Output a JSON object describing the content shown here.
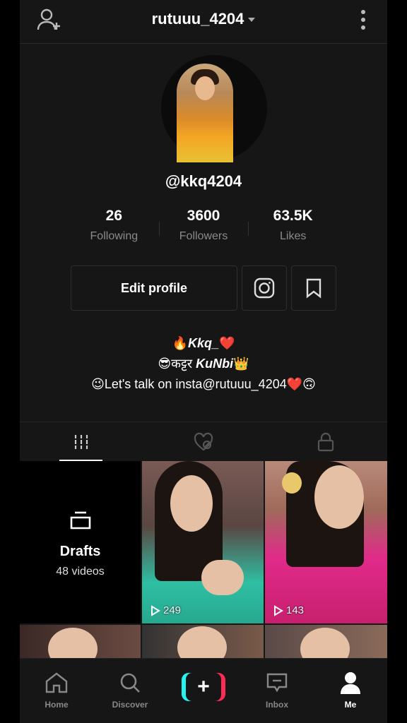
{
  "header": {
    "username": "rutuuu_4204"
  },
  "profile": {
    "handle": "@kkq4204"
  },
  "stats": [
    {
      "value": "26",
      "label": "Following"
    },
    {
      "value": "3600",
      "label": "Followers"
    },
    {
      "value": "63.5K",
      "label": "Likes"
    }
  ],
  "actions": {
    "edit_profile": "Edit profile"
  },
  "bio": {
    "line1_emoji_a": "🔥",
    "line1_text": "Kkq_",
    "line1_emoji_b": "❤️",
    "line2_emoji_a": "😎",
    "line2_text_a": "कट्टर ",
    "line2_text_b": "KuNbi",
    "line2_emoji_b": "👑",
    "line3_emoji_a": "😉",
    "line3_text": "Let's talk on insta@rutuuu_4204",
    "line3_emoji_b": "❤️🙃"
  },
  "drafts": {
    "title": "Drafts",
    "count": "48 videos"
  },
  "videos": [
    {
      "views": "249"
    },
    {
      "views": "143"
    }
  ],
  "nav": {
    "home": "Home",
    "discover": "Discover",
    "create": "+",
    "inbox": "Inbox",
    "me": "Me"
  },
  "colors": {
    "accent_cyan": "#25f4ee",
    "accent_red": "#fe2c55",
    "background": "#161616"
  }
}
